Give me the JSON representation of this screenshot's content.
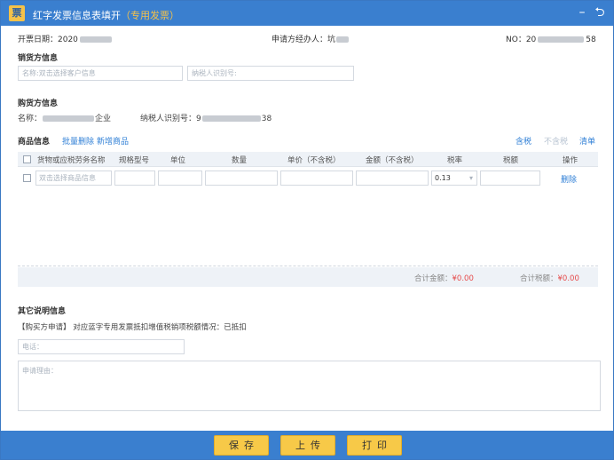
{
  "window": {
    "logo_text": "票",
    "title_main": "红字发票信息表填开",
    "title_paren_open": "（",
    "title_sub": "专用发票",
    "title_paren_close": "）",
    "minimize_glyph": "–",
    "back_glyph": "⮌"
  },
  "meta": {
    "invoice_date_label": "开票日期：2020",
    "applicant_label": "申请方经办人：坑",
    "number_label": "NO：20",
    "number_suffix": "58"
  },
  "seller": {
    "section_title": "销货方信息",
    "name_placeholder": "名称:双击选择客户信息",
    "taxid_placeholder": "纳税人识别号:"
  },
  "buyer": {
    "section_title": "购货方信息",
    "name_prefix": "名称：",
    "name_suffix": "企业",
    "taxid_prefix": "纳税人识别号：9",
    "taxid_suffix": "38"
  },
  "goods": {
    "section_title": "商品信息",
    "batch_delete": "批量删除",
    "add_item": "新增商品",
    "tax_included": "含税",
    "tax_excluded": "不含税",
    "list": "清单",
    "columns": [
      "货物或应税劳务名称",
      "规格型号",
      "单位",
      "数量",
      "单价（不含税）",
      "金额（不含税）",
      "税率",
      "税额",
      "操作"
    ],
    "row": {
      "name_placeholder": "双击选择商品信息",
      "tax_rate": "0.13",
      "delete": "删除"
    },
    "total_amount_label": "合计金额：",
    "total_amount_value": "¥0.00",
    "total_tax_label": "合计税额：",
    "total_tax_value": "¥0.00"
  },
  "other": {
    "section_title": "其它说明信息",
    "buyer_apply_note": "【购买方申请】 对应蓝字专用发票抵扣增值税销项税额情况：已抵扣",
    "phone_placeholder": "电话：",
    "reason_placeholder": "申请理由："
  },
  "footer": {
    "save": "保存",
    "upload": "上传",
    "print": "打印"
  }
}
